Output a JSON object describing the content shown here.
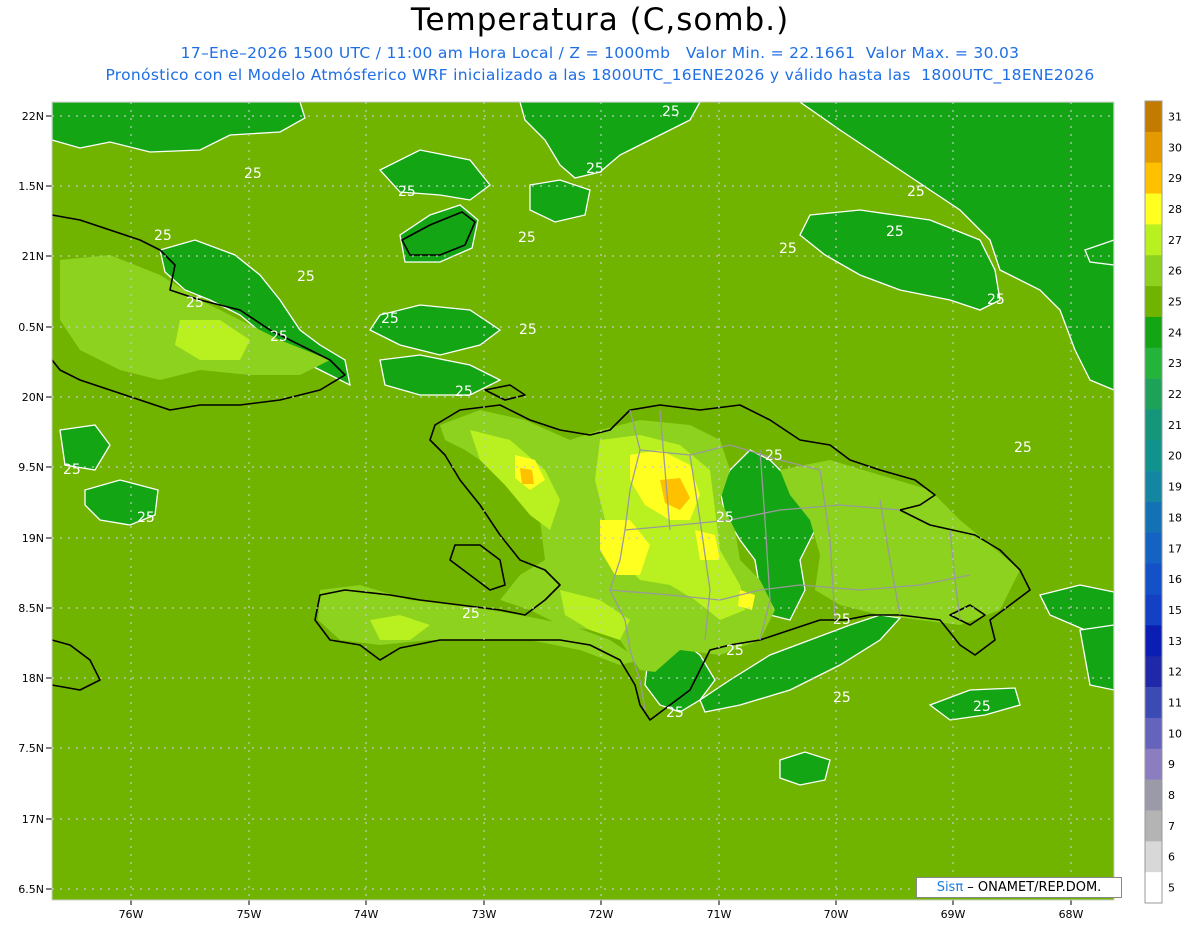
{
  "title": "Temperatura (C,somb.)",
  "subtitle_line1": "17–Ene–2026 1500 UTC / 11:00 am Hora Local / Z = 1000mb   Valor Min. = 22.1661  Valor Max. = 30.03",
  "subtitle_line2": "Pronóstico con el Modelo Atmósferico WRF inicializado a las 1800UTC_16ENE2026 y válido hasta las  1800UTC_18ENE2026",
  "credit": {
    "sis": "Sisπ",
    "rest": " – ONAMET/REP.DOM."
  },
  "lat_labels": [
    "22N",
    "1.5N",
    "21N",
    "0.5N",
    "20N",
    "9.5N",
    "19N",
    "8.5N",
    "18N",
    "7.5N",
    "17N",
    "6.5N"
  ],
  "lon_labels": [
    "76W",
    "75W",
    "74W",
    "73W",
    "72W",
    "71W",
    "70W",
    "69W",
    "68W"
  ],
  "contour_label": "25",
  "colorbar": {
    "levels": [
      "31",
      "30",
      "29",
      "28",
      "27",
      "26",
      "25",
      "24",
      "23",
      "22",
      "21",
      "20",
      "19",
      "18",
      "17",
      "16",
      "15",
      "13",
      "12",
      "11",
      "10",
      "9",
      "8",
      "7",
      "6",
      "5"
    ],
    "colors": [
      "#c27a00",
      "#e39a00",
      "#ffc000",
      "#ffff20",
      "#b8f020",
      "#8cd21e",
      "#70b400",
      "#14a514",
      "#24b43c",
      "#1ea25a",
      "#14967a",
      "#12928c",
      "#1486a2",
      "#1472b4",
      "#1462c2",
      "#1450c8",
      "#1440c4",
      "#0a1eb4",
      "#1e28a8",
      "#3c4ab4",
      "#6464bc",
      "#8c7cc0",
      "#9a9aa8",
      "#b4b4b4",
      "#d8d8d8",
      "#ffffff"
    ]
  },
  "colors": {
    "base": "#70b400",
    "cool": "#14a514",
    "warm1": "#8cd21e",
    "warm2": "#b8f020",
    "hot": "#ffff20",
    "hotter": "#ffc000",
    "coast": "#000000",
    "contour": "#ffffff",
    "border": "#9a9a9a"
  }
}
